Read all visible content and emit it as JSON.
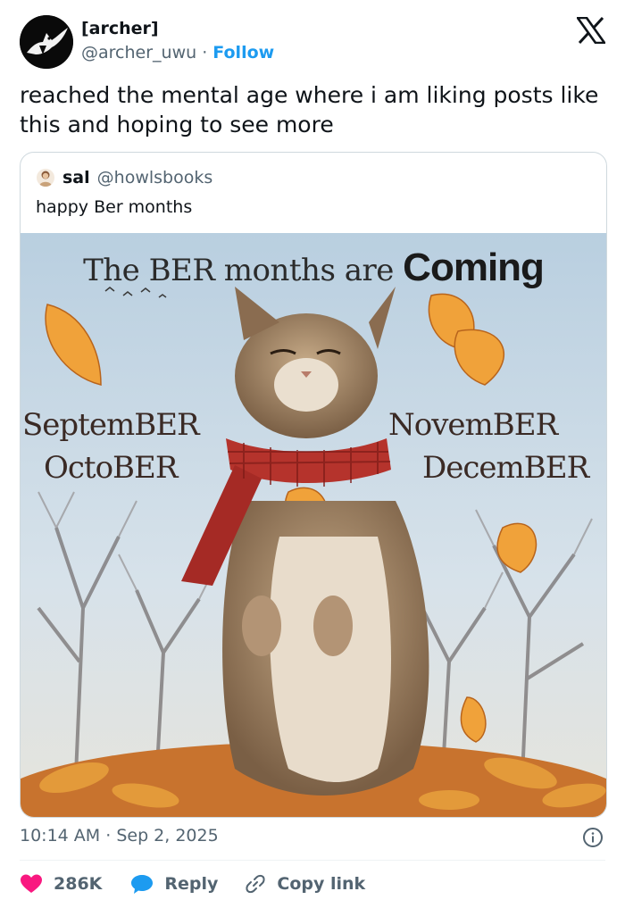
{
  "author": {
    "display_name": "[archer]",
    "handle": "@archer_uwu",
    "separator": "·",
    "follow_label": "Follow"
  },
  "tweet": {
    "text": "reached the mental age where i am liking posts like this and hoping to see more"
  },
  "quote": {
    "name": "sal",
    "handle": "@howlsbooks",
    "text": "happy Ber months",
    "image": {
      "title_prefix": "The BER months are",
      "title_coming": "Coming",
      "month_1": "SeptemBER",
      "month_2": "OctoBER",
      "month_3": "NovemBER",
      "month_4": "DecemBER"
    }
  },
  "meta": {
    "time": "10:14 AM",
    "dot": "·",
    "date": "Sep 2, 2025"
  },
  "actions": {
    "likes": "286K",
    "reply": "Reply",
    "copy_link": "Copy link"
  },
  "colors": {
    "accent": "#1d9bf0",
    "like": "#f91880",
    "secondary_text": "#536471",
    "border": "#cfd9de"
  },
  "icons": {
    "logo": "x-logo-icon",
    "info": "info-icon",
    "like": "heart-icon",
    "reply": "speech-bubble-icon",
    "link": "link-icon"
  }
}
